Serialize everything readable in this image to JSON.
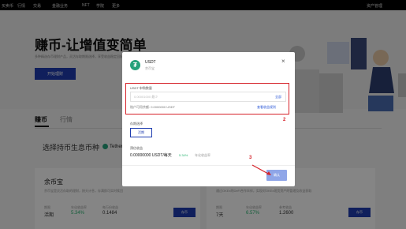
{
  "nav": {
    "items": [
      "买卖币",
      "行情",
      "交易",
      "金融业务",
      "NFT",
      "学院",
      "更多"
    ],
    "right": "资产管理"
  },
  "hero": {
    "title": "赚币-让增值变简单",
    "subtitle": "多种精选存币理财产品，灵活存取期限选择，享受收益稳定回报",
    "button": "开始理财"
  },
  "tabs": [
    "赚币",
    "行情"
  ],
  "select_coin": {
    "label": "选择持币生息币种",
    "chip": "Tether"
  },
  "cards": [
    {
      "title": "余币宝",
      "desc": "余币宝是灵活存取的理财，按天计息，存满即可实时赎回",
      "stats": [
        {
          "label": "期限",
          "value": "活期"
        },
        {
          "label": "年化收益率",
          "value": "5.34%"
        },
        {
          "label": "每万份收益",
          "value": "0.1484"
        }
      ],
      "button": "存币"
    },
    {
      "title": "",
      "desc": "通过OKEx的DeFi合作伙伴，实现对OKEx现货资产的管理及收益获取",
      "stats": [
        {
          "label": "期限",
          "value": "7天"
        },
        {
          "label": "年化收益率",
          "value": "6.57%"
        },
        {
          "label": "参考收益",
          "value": "1.2600"
        }
      ],
      "button": "存币"
    }
  ],
  "modal": {
    "coin": "USDT",
    "coin_sub": "余币宝",
    "close": "×",
    "amount_label": "USDT 申购数量",
    "amount_placeholder": "0.00001000 最少",
    "all": "全部",
    "available": "账户可用余额: 0.0000000 USDT",
    "rule": "查看收益规则",
    "term_label": "存期选择",
    "term_button": "活期",
    "earn_label": "预估收益",
    "earn_value": "0.00000000 USDT/每天",
    "earn_rate": "5.34%",
    "earn_note": "年化收益率",
    "confirm": "确认"
  },
  "annotations": {
    "box2": "2",
    "arrow3": "3"
  },
  "colors": {
    "primary": "#1f3db0",
    "tether": "#26a17b",
    "highlight": "#d6232a",
    "positive": "#2bb673"
  }
}
